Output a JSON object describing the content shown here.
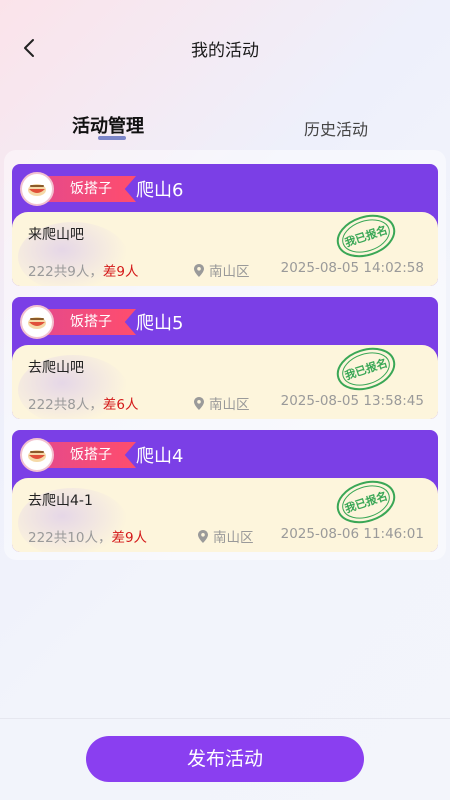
{
  "header": {
    "title": "我的活动"
  },
  "tabs": [
    {
      "label": "活动管理",
      "active": true
    },
    {
      "label": "历史活动",
      "active": false
    }
  ],
  "cards": [
    {
      "tag": "饭搭子",
      "title": "爬山6",
      "description": "来爬山吧",
      "count_text": "222共9人，",
      "short_text": "差9人",
      "location": "南山区",
      "time": "2025-08-05 14:02:58",
      "stamp": "我已报名"
    },
    {
      "tag": "饭搭子",
      "title": "爬山5",
      "description": "去爬山吧",
      "count_text": "222共8人，",
      "short_text": "差6人",
      "location": "南山区",
      "time": "2025-08-05 13:58:45",
      "stamp": "我已报名"
    },
    {
      "tag": "饭搭子",
      "title": "爬山4",
      "description": "去爬山4-1",
      "count_text": "222共10人，",
      "short_text": "差9人",
      "location": "南山区",
      "time": "2025-08-06 11:46:01",
      "stamp": "我已报名"
    }
  ],
  "publish_label": "发布活动",
  "colors": {
    "accent": "#8a3ff0",
    "card_header": "#7b3fe6",
    "card_body": "#fdf5dc",
    "ribbon": "#ff4d6d",
    "short": "#d41a1a",
    "stamp": "#3aa756"
  },
  "icons": {
    "back": "chevron-left-icon",
    "location": "location-pin-icon",
    "avatar": "food-avatar-icon"
  }
}
